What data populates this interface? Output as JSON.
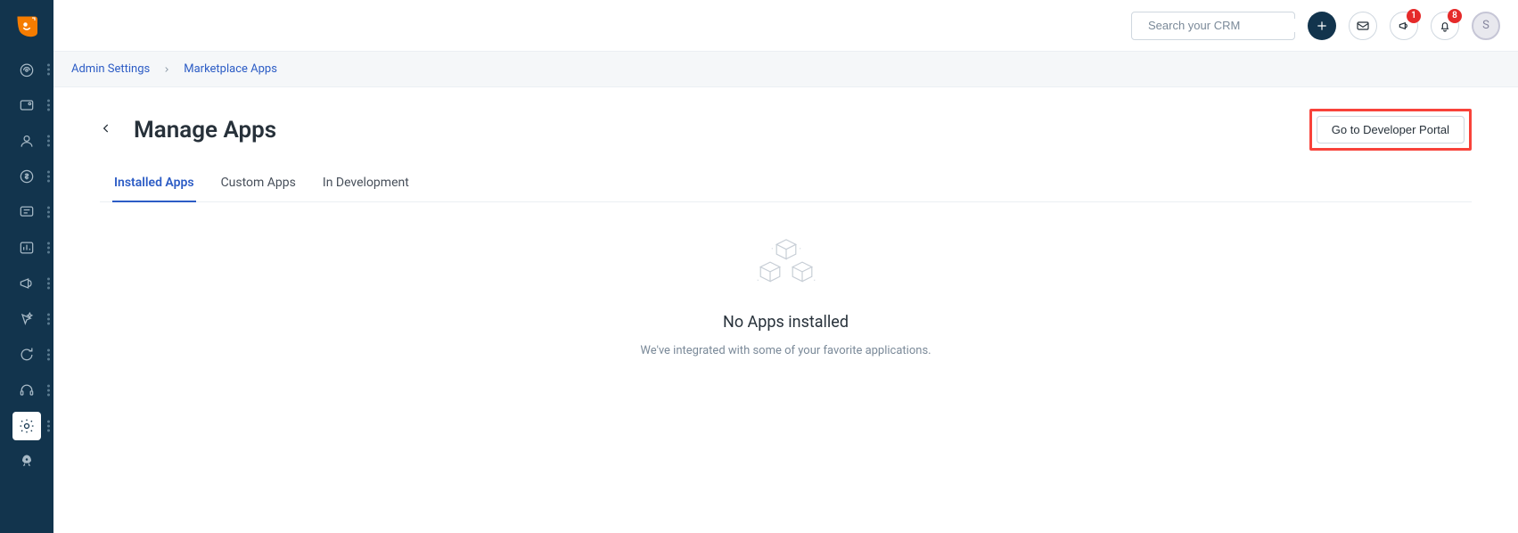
{
  "header": {
    "search_placeholder": "Search your CRM",
    "badge_announcements": "1",
    "badge_notifications": "8",
    "avatar_initial": "S"
  },
  "breadcrumb": {
    "admin_settings": "Admin Settings",
    "marketplace_apps": "Marketplace Apps"
  },
  "page": {
    "title": "Manage Apps",
    "dev_portal_button": "Go to Developer Portal"
  },
  "tabs": {
    "installed": "Installed Apps",
    "custom": "Custom Apps",
    "in_dev": "In Development"
  },
  "empty": {
    "title": "No Apps installed",
    "subtitle": "We've integrated with some of your favorite applications."
  }
}
